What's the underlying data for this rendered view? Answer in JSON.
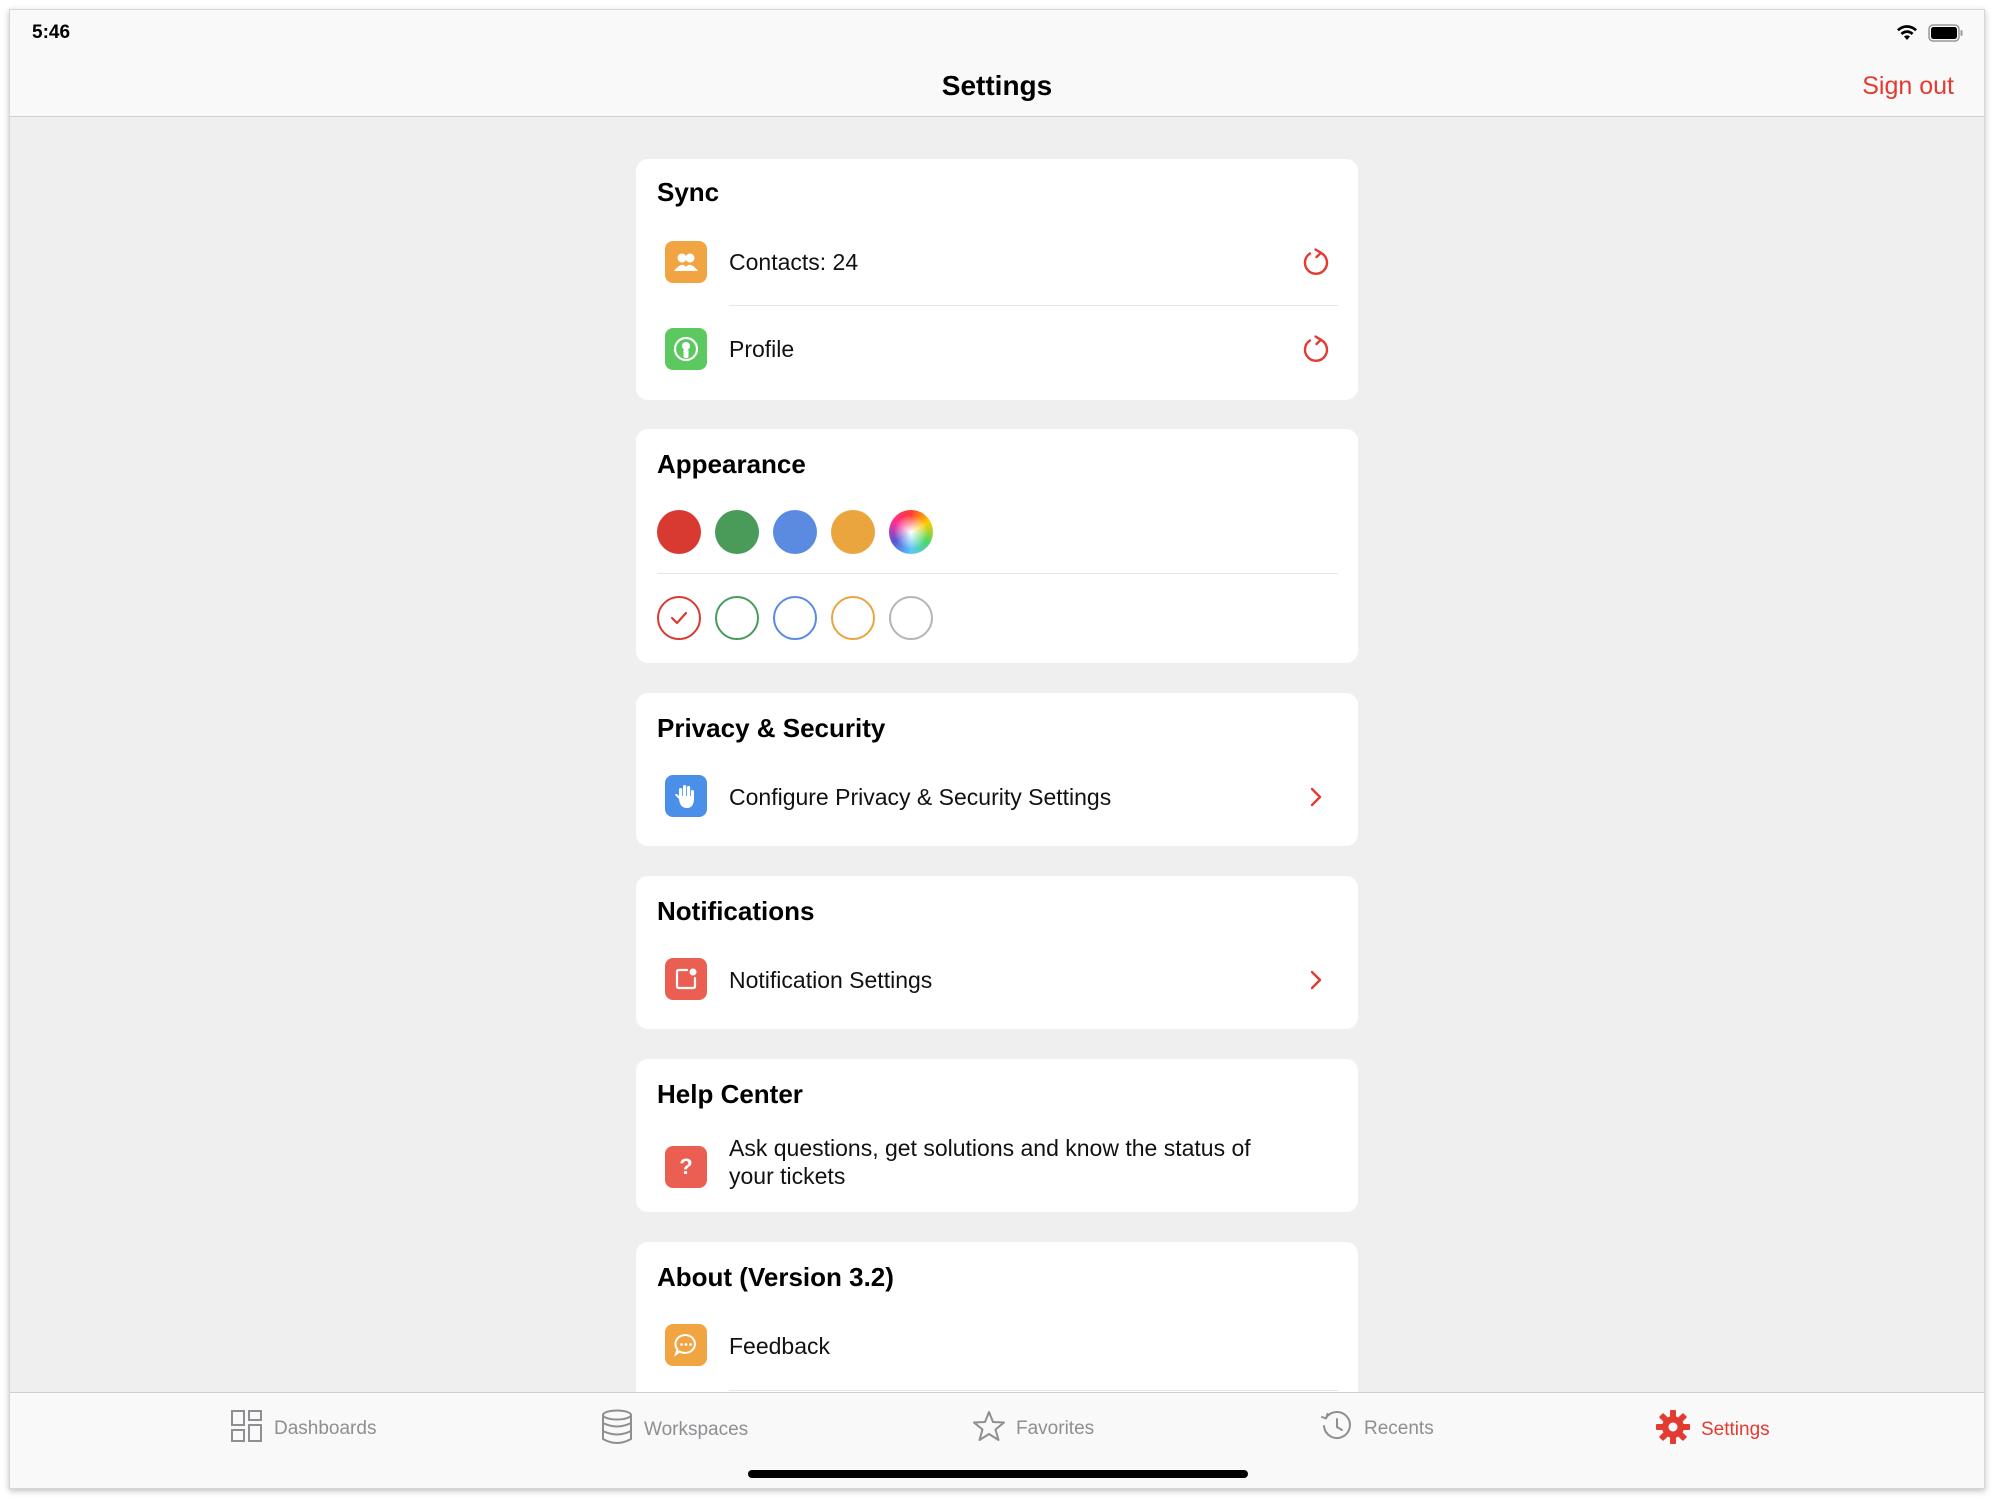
{
  "status_bar": {
    "time": "5:46"
  },
  "nav": {
    "title": "Settings",
    "sign_out": "Sign out"
  },
  "colors": {
    "accent": "#e33b31"
  },
  "sections": {
    "sync": {
      "title": "Sync",
      "items": [
        {
          "label": "Contacts: 24",
          "icon": "contacts-icon",
          "action": "refresh-icon"
        },
        {
          "label": "Profile",
          "icon": "profile-icon",
          "action": "refresh-icon"
        }
      ]
    },
    "appearance": {
      "title": "Appearance",
      "theme_colors": [
        "#d83a32",
        "#4a9a5a",
        "#5a8be0",
        "#eaa53f",
        "multicolor"
      ],
      "selected_index": 0
    },
    "privacy": {
      "title": "Privacy & Security",
      "item": {
        "label": "Configure Privacy & Security Settings",
        "icon": "hand-icon"
      }
    },
    "notifications": {
      "title": "Notifications",
      "item": {
        "label": "Notification Settings",
        "icon": "notification-badge-icon"
      }
    },
    "help": {
      "title": "Help Center",
      "item": {
        "label": "Ask questions, get solutions and know the status of your tickets",
        "icon": "question-icon"
      }
    },
    "about": {
      "title": "About (Version 3.2)",
      "item": {
        "label": "Feedback",
        "icon": "chat-bubble-icon"
      }
    }
  },
  "tabs": [
    {
      "label": "Dashboards",
      "icon": "grid-icon",
      "active": false
    },
    {
      "label": "Workspaces",
      "icon": "database-icon",
      "active": false
    },
    {
      "label": "Favorites",
      "icon": "star-icon",
      "active": false
    },
    {
      "label": "Recents",
      "icon": "clock-icon",
      "active": false
    },
    {
      "label": "Settings",
      "icon": "gear-icon",
      "active": true
    }
  ]
}
